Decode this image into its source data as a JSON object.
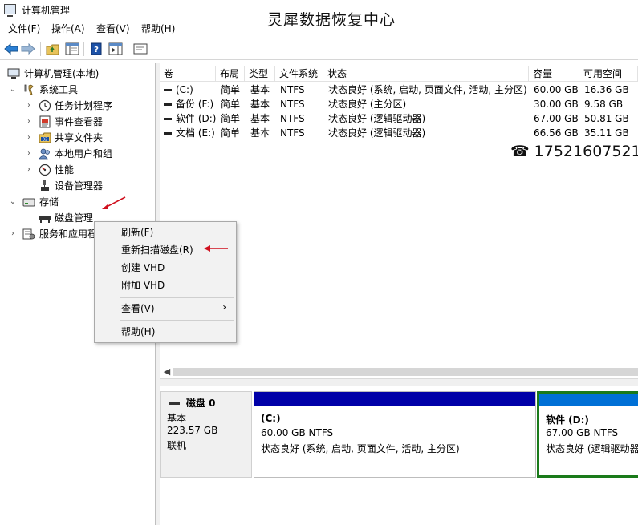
{
  "window": {
    "title": "计算机管理"
  },
  "watermark": "灵犀数据恢复中心",
  "phone": {
    "glyph": "☎",
    "number": "17521607521"
  },
  "menubar": [
    "文件(F)",
    "操作(A)",
    "查看(V)",
    "帮助(H)"
  ],
  "tree": {
    "root": "计算机管理(本地)",
    "system_tools": "系统工具",
    "task_scheduler": "任务计划程序",
    "event_viewer": "事件查看器",
    "shared_folders": "共享文件夹",
    "local_users": "本地用户和组",
    "performance": "性能",
    "device_manager": "设备管理器",
    "storage": "存储",
    "disk_management": "磁盘管理",
    "services": "服务和应用程序"
  },
  "volume_list": {
    "columns": [
      "卷",
      "布局",
      "类型",
      "文件系统",
      "状态",
      "容量",
      "可用空间"
    ],
    "rows": [
      [
        "(C:)",
        "简单",
        "基本",
        "NTFS",
        "状态良好 (系统, 启动, 页面文件, 活动, 主分区)",
        "60.00 GB",
        "16.36 GB"
      ],
      [
        "备份 (F:)",
        "简单",
        "基本",
        "NTFS",
        "状态良好 (主分区)",
        "30.00 GB",
        "9.58 GB"
      ],
      [
        "软件 (D:)",
        "简单",
        "基本",
        "NTFS",
        "状态良好 (逻辑驱动器)",
        "67.00 GB",
        "50.81 GB"
      ],
      [
        "文档 (E:)",
        "简单",
        "基本",
        "NTFS",
        "状态良好 (逻辑驱动器)",
        "66.56 GB",
        "35.11 GB"
      ]
    ]
  },
  "disk": {
    "name": "磁盘 0",
    "type": "基本",
    "size": "223.57 GB",
    "status": "联机",
    "partitions": [
      {
        "label": "(C:)",
        "size": "60.00 GB NTFS",
        "status": "状态良好 (系统, 启动, 页面文件, 活动, 主分区)"
      },
      {
        "label": "软件  (D:)",
        "size": "67.00 GB NTFS",
        "status": "状态良好 (逻辑驱动器)"
      }
    ]
  },
  "context_menu": {
    "refresh": "刷新(F)",
    "rescan": "重新扫描磁盘(R)",
    "create_vhd": "创建 VHD",
    "attach_vhd": "附加 VHD",
    "view": "查看(V)",
    "view_arrow": "›",
    "help": "帮助(H)"
  },
  "colors": {
    "primary_partition_bar": "#0000a8",
    "logical_partition_bar": "#0070d6",
    "selected_border": "#1a7a1a",
    "annotation_arrow": "#d0101e"
  }
}
